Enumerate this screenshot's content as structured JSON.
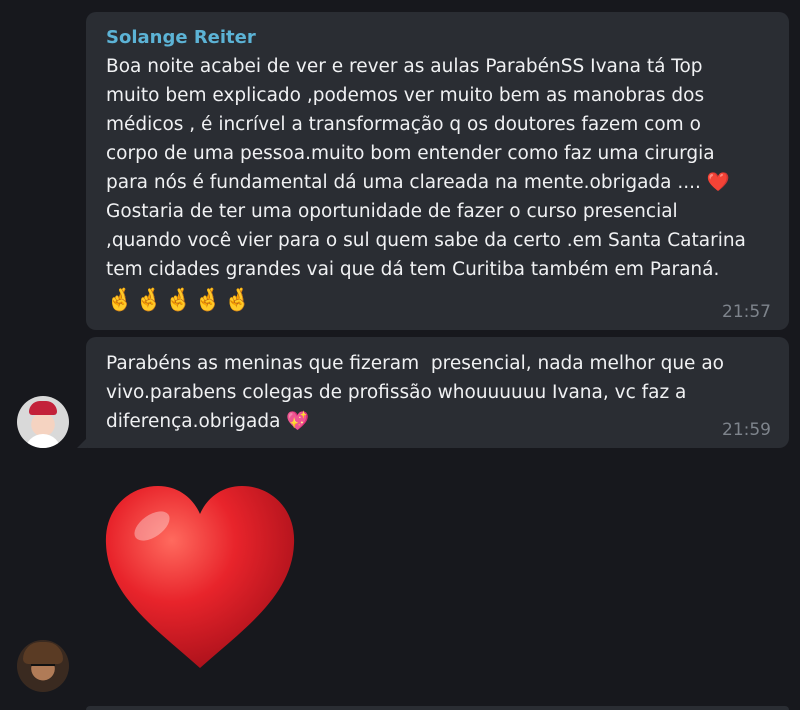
{
  "messages": [
    {
      "sender": "Solange Reiter",
      "text": "Boa noite acabei de ver e rever as aulas ParabénSS Ivana tá Top\nmuito bem explicado ,podemos ver muito bem as manobras dos\nmédicos , é incrível a transformação q os doutores fazem com o\ncorpo de uma pessoa.muito bom entender como faz uma cirurgia\npara nós é fundamental dá uma clareada na mente.obrigada .... ",
      "text_emoji": "❤️",
      "text_cont": "\nGostaria de ter uma oportunidade de fazer o curso presencial\n,quando você vier para o sul quem sabe da certo .em Santa Catarina\ntem cidades grandes vai que dá tem Curitiba também em Paraná.",
      "emoji_row": "🤞🤞🤞🤞🤞",
      "time": "21:57"
    },
    {
      "text": "Parabéns as meninas que fizeram  presencial, nada melhor que ao\nvivo.parabens colegas de profissão whouuuuuu Ivana, vc faz a\ndiferença.obrigada ",
      "text_emoji": "💖",
      "time": "21:59"
    }
  ],
  "sticker": {
    "icon": "red-heart-icon"
  },
  "colors": {
    "background": "#17181d",
    "bubble": "#2a2d33",
    "sender_name": "#5cb3d6",
    "text": "#f0f1f3",
    "time": "#7e848c",
    "heart": "#e5252a"
  }
}
